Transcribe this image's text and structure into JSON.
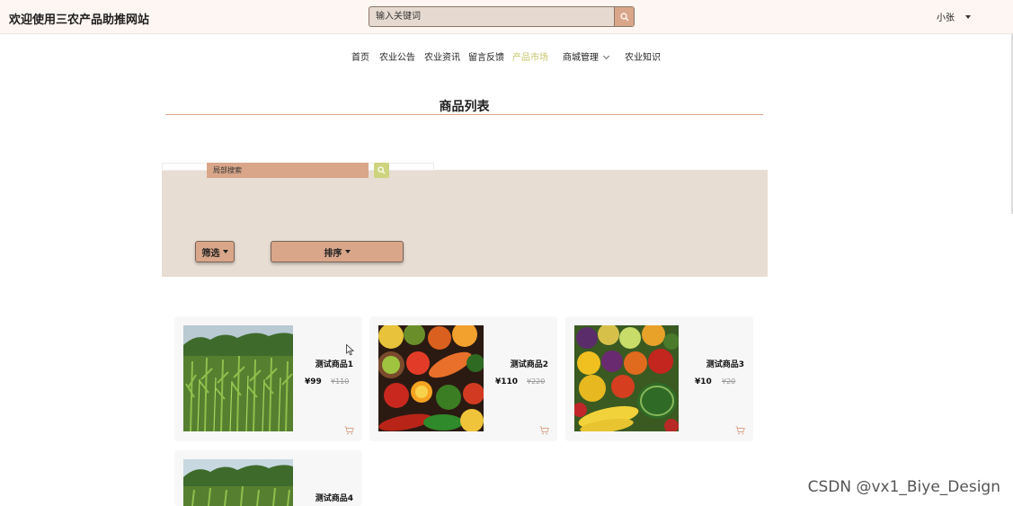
{
  "header": {
    "site_title": "欢迎使用三农产品助推网站",
    "search_placeholder": "输入关键词",
    "user_name": "小张"
  },
  "nav": {
    "items": [
      {
        "label": "首页"
      },
      {
        "label": "农业公告"
      },
      {
        "label": "农业资讯"
      },
      {
        "label": "留言反馈"
      },
      {
        "label": "产品市场",
        "active": true
      },
      {
        "label": "商城管理",
        "has_dropdown": true
      },
      {
        "label": "农业知识"
      }
    ]
  },
  "section": {
    "title": "商品列表"
  },
  "filters": {
    "local_search_placeholder": "局部搜索",
    "filter_label": "筛选",
    "sort_label": "排序"
  },
  "products": [
    {
      "name": "测试商品1",
      "price": "¥99",
      "original_price": "¥110",
      "image": "cornfield"
    },
    {
      "name": "测试商品2",
      "price": "¥110",
      "original_price": "¥220",
      "image": "vegetables"
    },
    {
      "name": "测试商品3",
      "price": "¥10",
      "original_price": "¥20",
      "image": "fruits"
    },
    {
      "name": "测试商品4",
      "image": "cornfield"
    }
  ],
  "watermark": "CSDN @vx1_Biye_Design",
  "colors": {
    "accent": "#d9a68a",
    "active_nav": "#c7c46a",
    "panel_bg": "#e8ddd2",
    "header_bg": "#fdf6f2"
  },
  "icons": [
    "search-icon",
    "caret-down-icon",
    "chevron-down-icon",
    "cart-icon"
  ]
}
